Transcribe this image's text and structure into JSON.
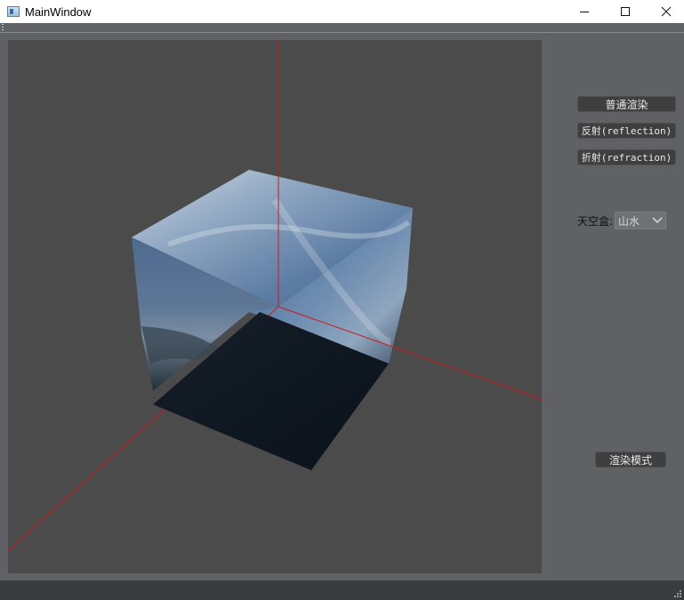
{
  "window": {
    "title": "MainWindow",
    "icon": "app-window-icon",
    "controls": [
      "minimize-icon",
      "maximize-icon",
      "close-icon"
    ]
  },
  "viewport": {
    "background": "#4b4b4b",
    "axis_color": "#d01818",
    "scene": "skybox-mapped cube with red coordinate axes"
  },
  "side_panel": {
    "normal_render_button": "普通渲染",
    "reflection_button": "反射(reflection)",
    "refraction_button": "折射(refraction)",
    "skybox_label": "天空盒:",
    "skybox_selected": "山水",
    "render_mode_button": "渲染模式"
  },
  "colors": {
    "panel_bg": "#5f6164",
    "button_bg": "#3f3f40",
    "button_text": "#e8e8e8",
    "statusbar_bg": "#3a3b3d"
  }
}
